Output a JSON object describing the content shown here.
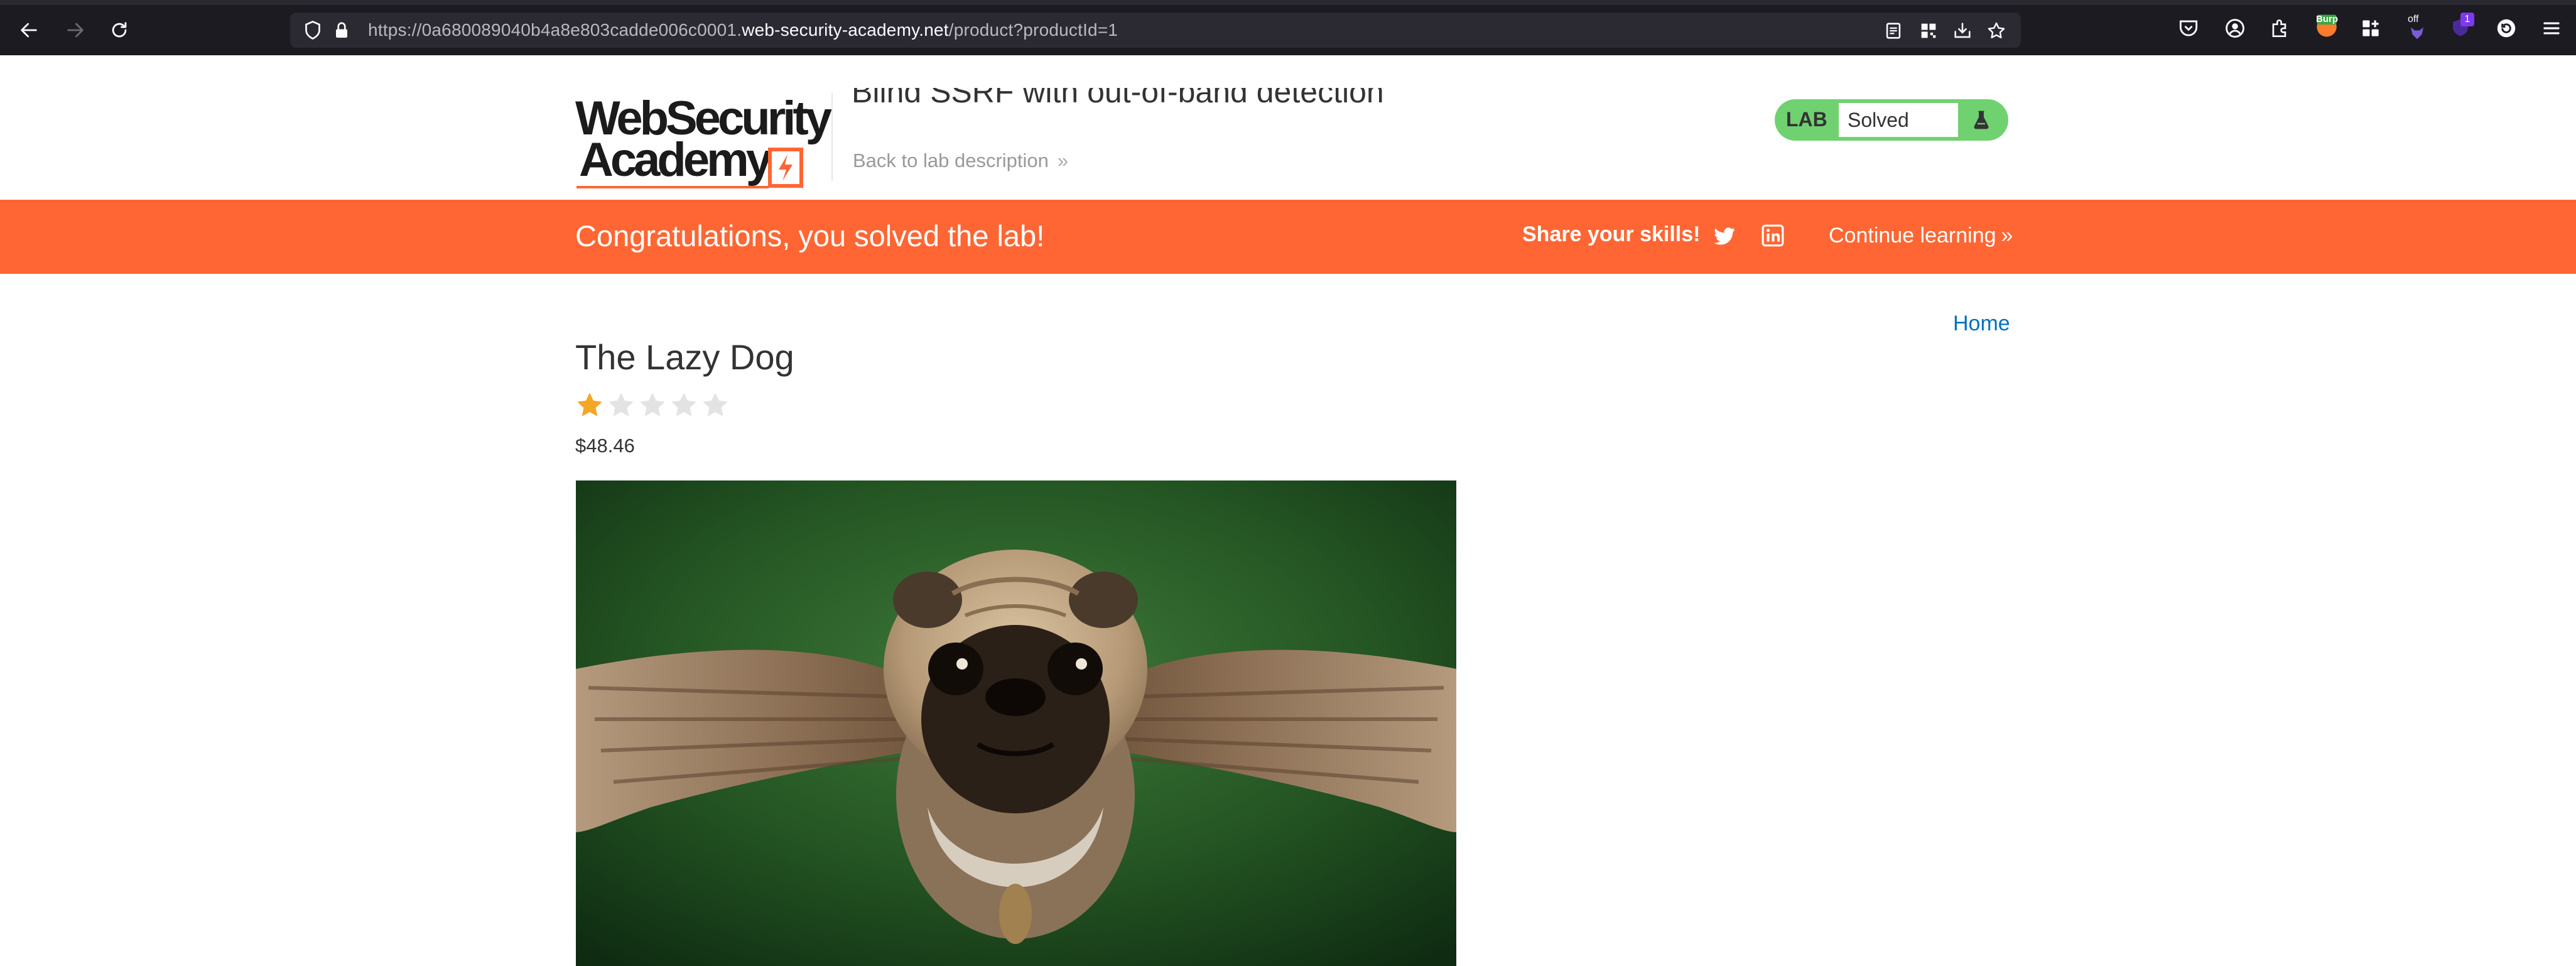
{
  "browser": {
    "url_prefix": "https://0a680089040b4a8e803cadde006c0001.",
    "url_host": "web-security-academy.net",
    "url_path": "/product?productId=1",
    "toolbar_badge_count": "1",
    "extension_label_burp": "Burp",
    "extension_label_off": "off"
  },
  "header": {
    "logo_line1": "WebSecurity",
    "logo_line2": "Academy",
    "lab_title": "Blind SSRF with out-of-band detection",
    "back_link": "Back to lab description",
    "badge_label": "LAB",
    "badge_status": "Solved"
  },
  "banner": {
    "message": "Congratulations, you solved the lab!",
    "share_label": "Share your skills!",
    "continue_label": "Continue learning"
  },
  "product": {
    "home_link": "Home",
    "title": "The Lazy Dog",
    "rating": 1,
    "rating_max": 5,
    "price": "$48.46"
  },
  "colors": {
    "accent": "#ff6633",
    "lab_badge": "#70d170",
    "link": "#0071bc",
    "star_filled": "#f5a623",
    "star_empty": "#e3e3e3"
  }
}
